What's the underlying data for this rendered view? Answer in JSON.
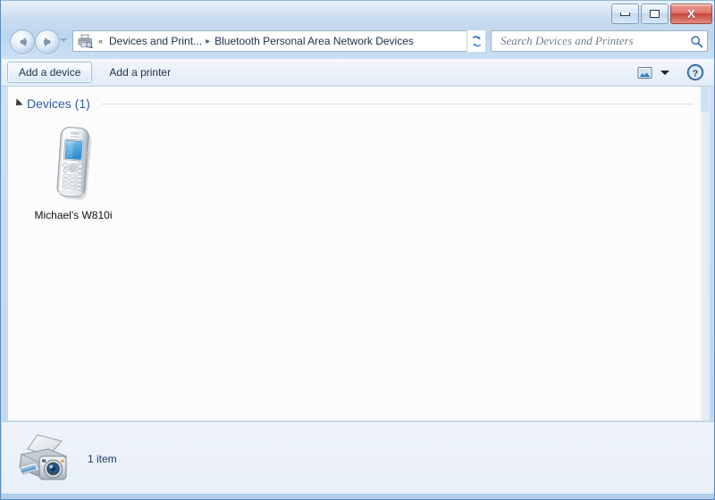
{
  "window": {
    "controls": {
      "minimize_label": "Minimize",
      "maximize_label": "Restore",
      "close_label": "X"
    }
  },
  "nav": {
    "back_label": "Back",
    "forward_label": "Forward",
    "history_label": "Recent pages",
    "refresh_label": "Refresh",
    "address_icon": "printer-icon",
    "breadcrumb_overflow": "«",
    "crumbs": [
      {
        "label": "Devices and Print...",
        "separator": "▸"
      },
      {
        "label": "Bluetooth Personal Area Network Devices",
        "separator": ""
      }
    ],
    "dropdown_label": "Previous locations"
  },
  "search": {
    "placeholder": "Search Devices and Printers",
    "value": "",
    "icon": "search-icon"
  },
  "toolbar": {
    "items": [
      {
        "label": "Add a device",
        "state": "hover"
      },
      {
        "label": "Add a printer",
        "state": "normal"
      }
    ],
    "view_icon": "view-options-icon",
    "view_dropdown_icon": "chevron-down-icon",
    "help_icon": "help-icon",
    "help_glyph": "?"
  },
  "content": {
    "group": {
      "label": "Devices (1)",
      "collapse_icon": "chevron-collapse-icon"
    },
    "devices": [
      {
        "name": "Michael's W810i",
        "icon": "mobile-phone-icon"
      }
    ]
  },
  "statusbar": {
    "icon": "devices-and-printers-icon",
    "text": "1 item"
  },
  "colors": {
    "accent_blue": "#2b5ca8",
    "status_text": "#17365d",
    "close_red": "#c9453c",
    "glass": "#c4d9ef",
    "content_bg": "#fcfcfc"
  }
}
